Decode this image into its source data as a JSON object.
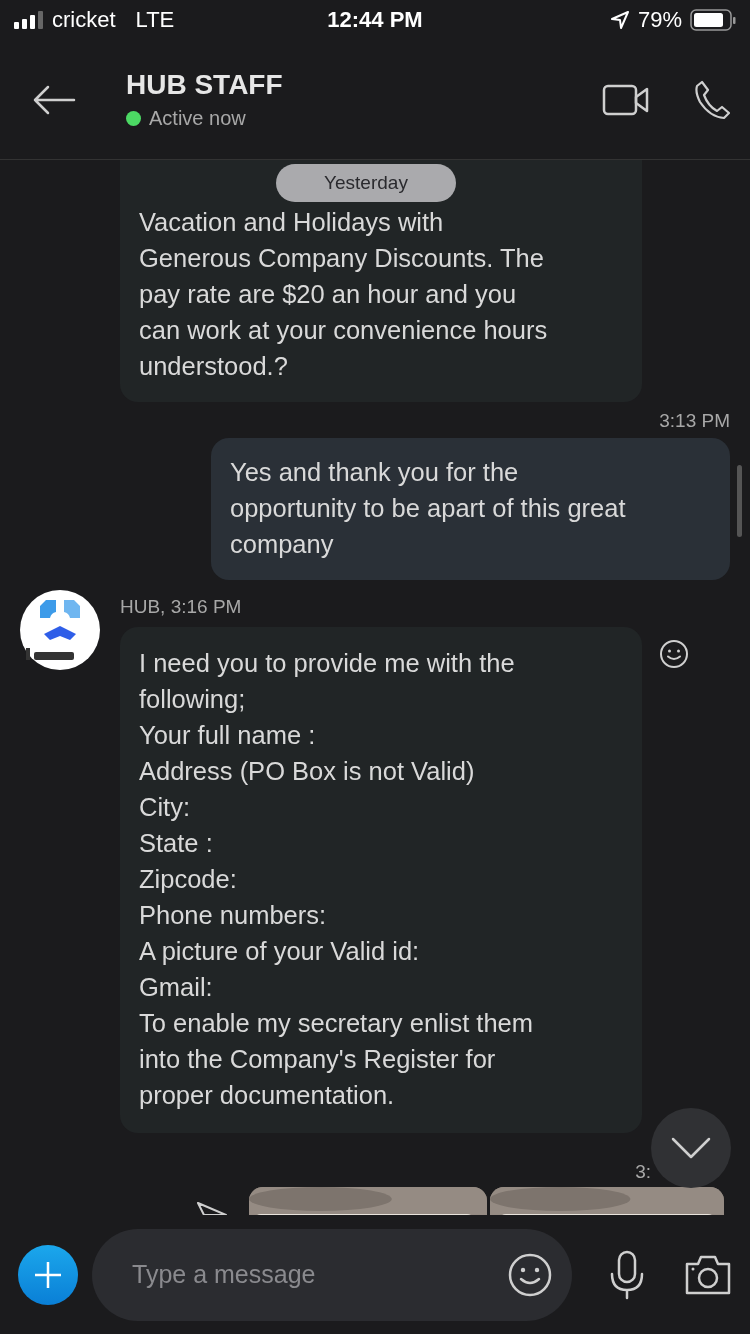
{
  "status_bar": {
    "carrier": "cricket",
    "network": "LTE",
    "time": "12:44 PM",
    "battery": "79%"
  },
  "header": {
    "title": "HUB STAFF",
    "status": "Active now",
    "online": true
  },
  "date_pill": "Yesterday",
  "messages": [
    {
      "kind": "incoming",
      "text": "Vacation and Holidays with\nGenerous Company Discounts. The\npay rate are $20 an hour and you\ncan work at your convenience hours\nunderstood.?"
    },
    {
      "kind": "time",
      "text": "3:13 PM"
    },
    {
      "kind": "outgoing",
      "text": "Yes and thank you for the\nopportunity to be apart of this great\ncompany"
    },
    {
      "kind": "incoming",
      "sender": "HUB, 3:16 PM",
      "text": "I need you to provide me with the\nfollowing;\nYour full name :\nAddress (PO Box is not Valid)\nCity:\nState :\nZipcode:\nPhone numbers:\nA picture of your Valid id:\nGmail:\nTo enable my secretary enlist them\ninto the Company's Register for\nproper documentation."
    },
    {
      "kind": "time",
      "text": "3:"
    },
    {
      "kind": "photos"
    }
  ],
  "composer": {
    "placeholder": "Type a message"
  }
}
